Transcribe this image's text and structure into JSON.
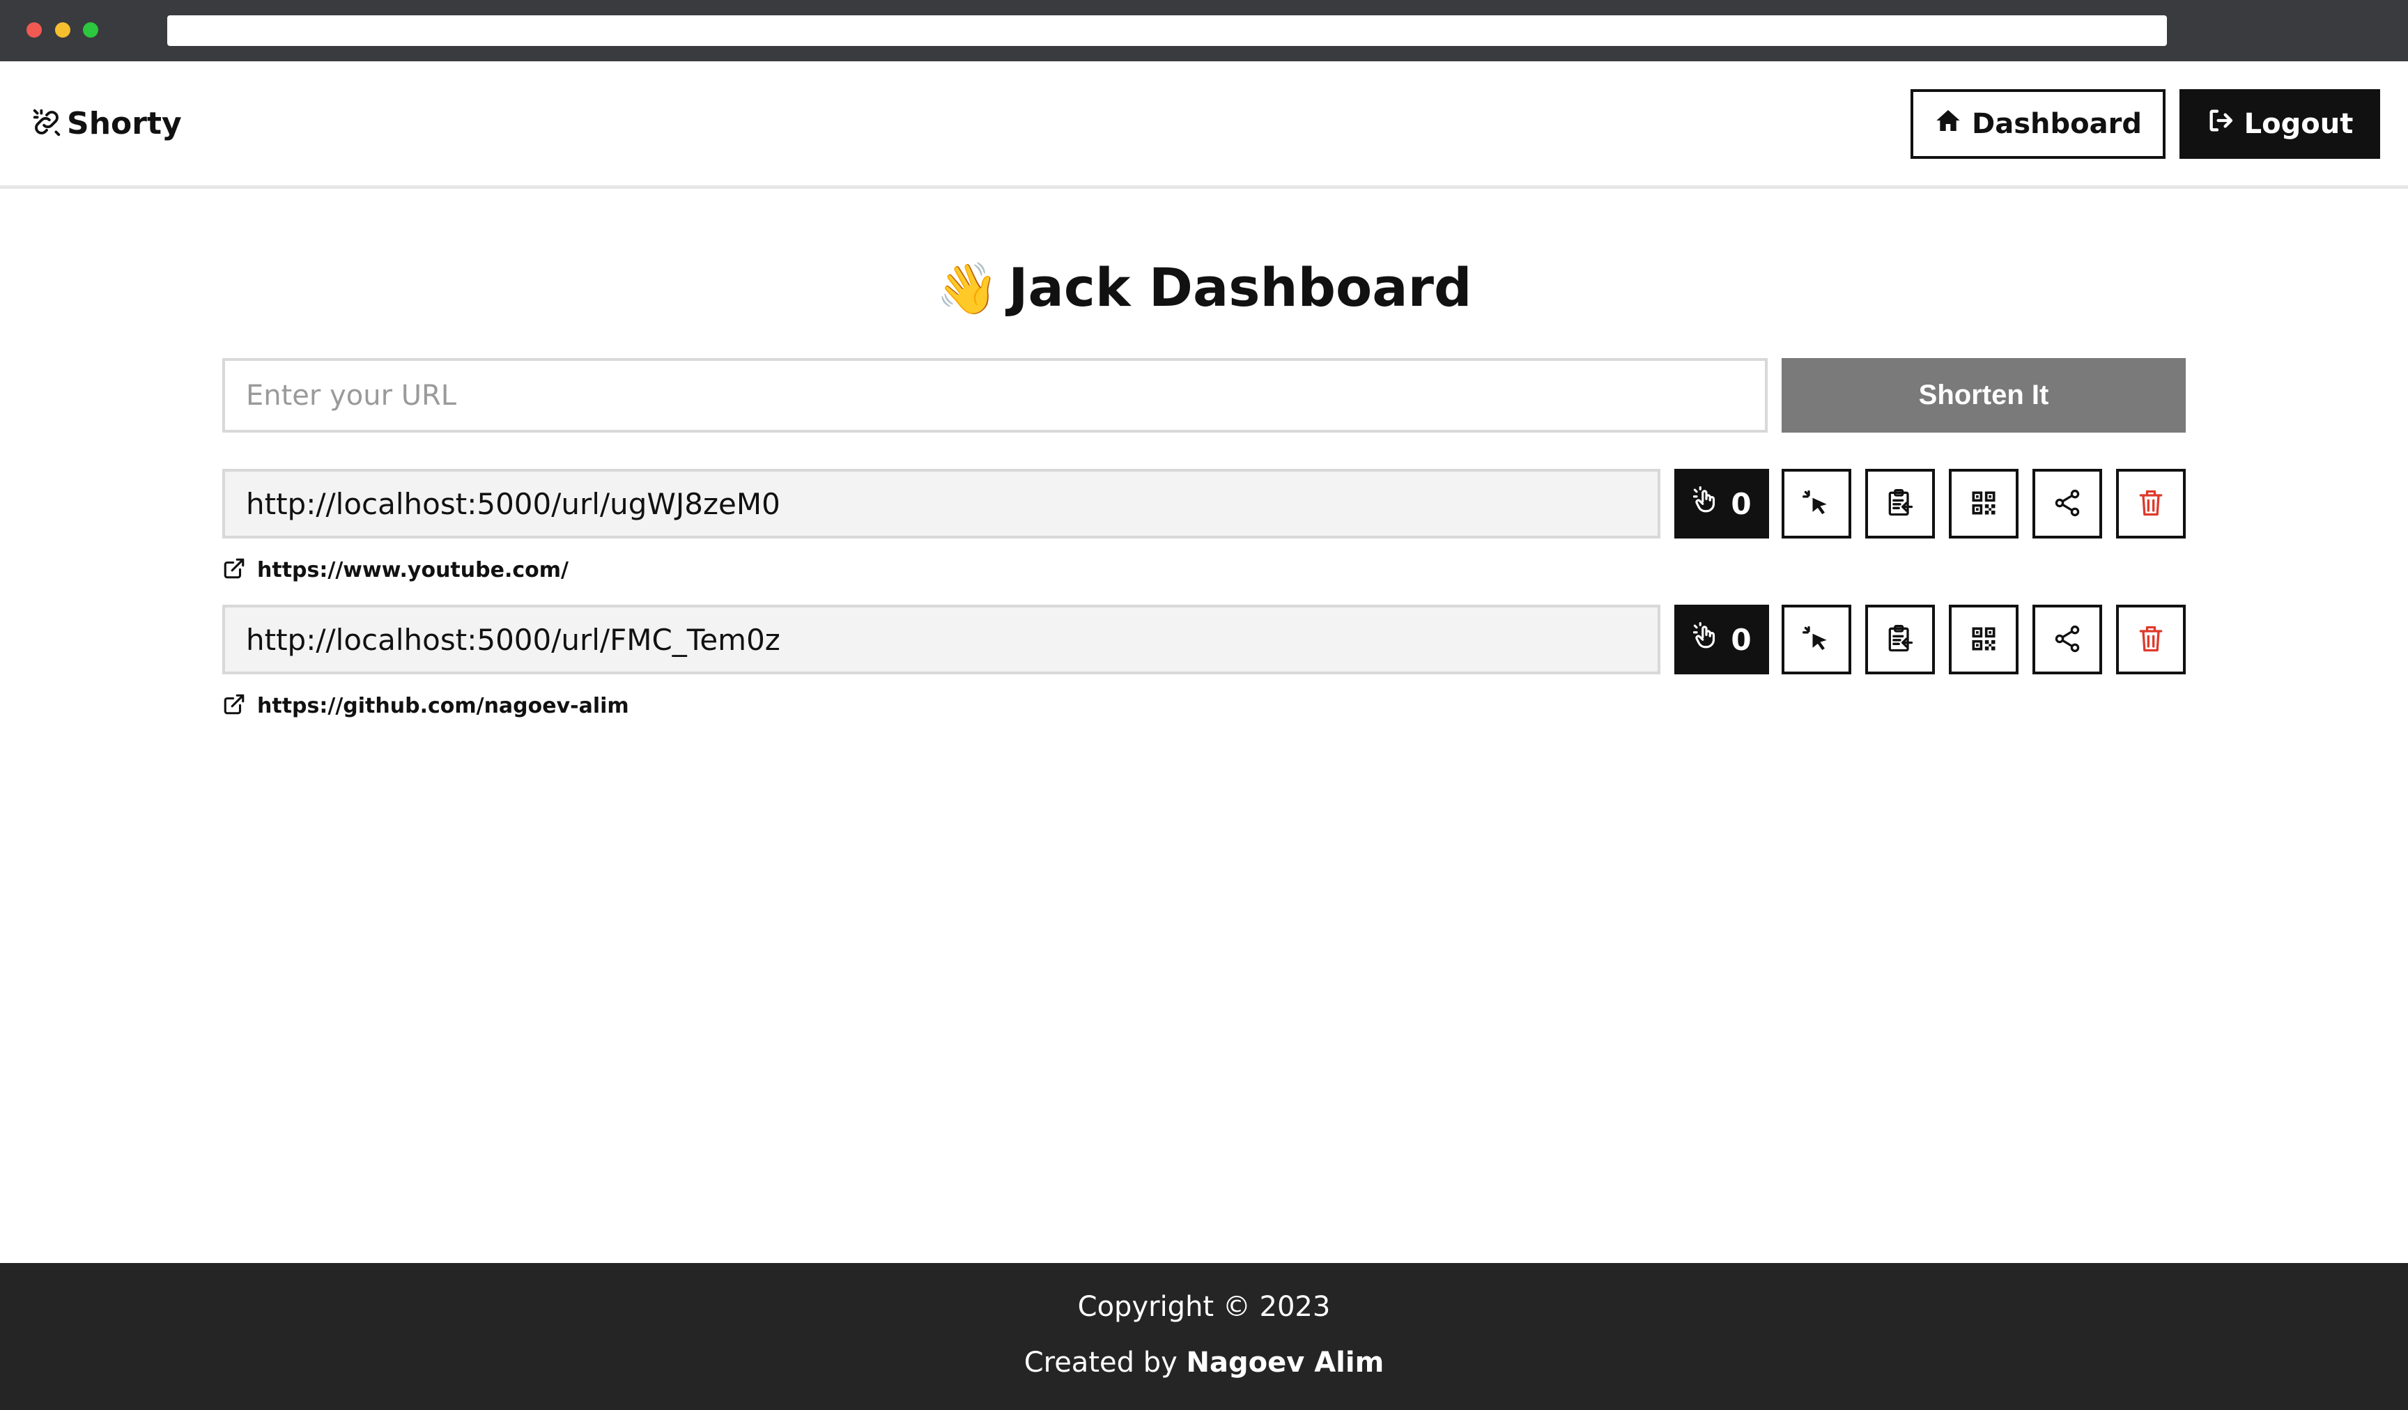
{
  "app": {
    "name": "Shorty"
  },
  "nav": {
    "dashboard_label": "Dashboard",
    "logout_label": "Logout"
  },
  "page": {
    "wave_emoji": "👋",
    "title": "Jack Dashboard"
  },
  "form": {
    "placeholder": "Enter your URL",
    "value": "",
    "submit_label": "Shorten It"
  },
  "links": [
    {
      "short_url": "http://localhost:5000/url/ugWJ8zeM0",
      "clicks": "0",
      "original_url": "https://www.youtube.com/"
    },
    {
      "short_url": "http://localhost:5000/url/FMC_Tem0z",
      "clicks": "0",
      "original_url": "https://github.com/nagoev-alim"
    }
  ],
  "footer": {
    "copyright": "Copyright © 2023",
    "created_prefix": "Created by",
    "author": "Nagoev Alim"
  },
  "colors": {
    "accent": "#111111",
    "delete": "#e0392b",
    "footer_bg": "#252525",
    "button_disabled": "#7a7a7a"
  }
}
